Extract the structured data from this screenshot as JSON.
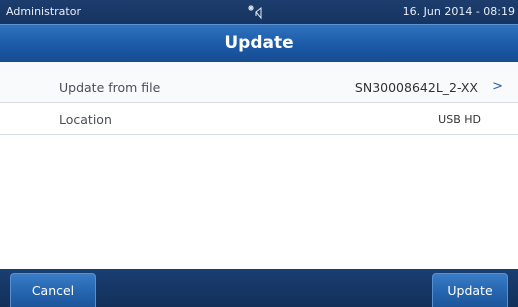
{
  "status": {
    "user": "Administrator",
    "icon": "connection-signal-icon",
    "datetime": "16. Jun 2014 - 08:19"
  },
  "header": {
    "title": "Update"
  },
  "settings": [
    {
      "label": "Update from file",
      "value": "SN30008642L_2-XX",
      "chevron": ">"
    },
    {
      "label": "Location",
      "value": "USB HD"
    }
  ],
  "footer": {
    "cancel_label": "Cancel",
    "update_label": "Update"
  },
  "colors": {
    "title_bar": "#1c5aa6",
    "status_bar": "#163460",
    "button": "#2463ad"
  }
}
